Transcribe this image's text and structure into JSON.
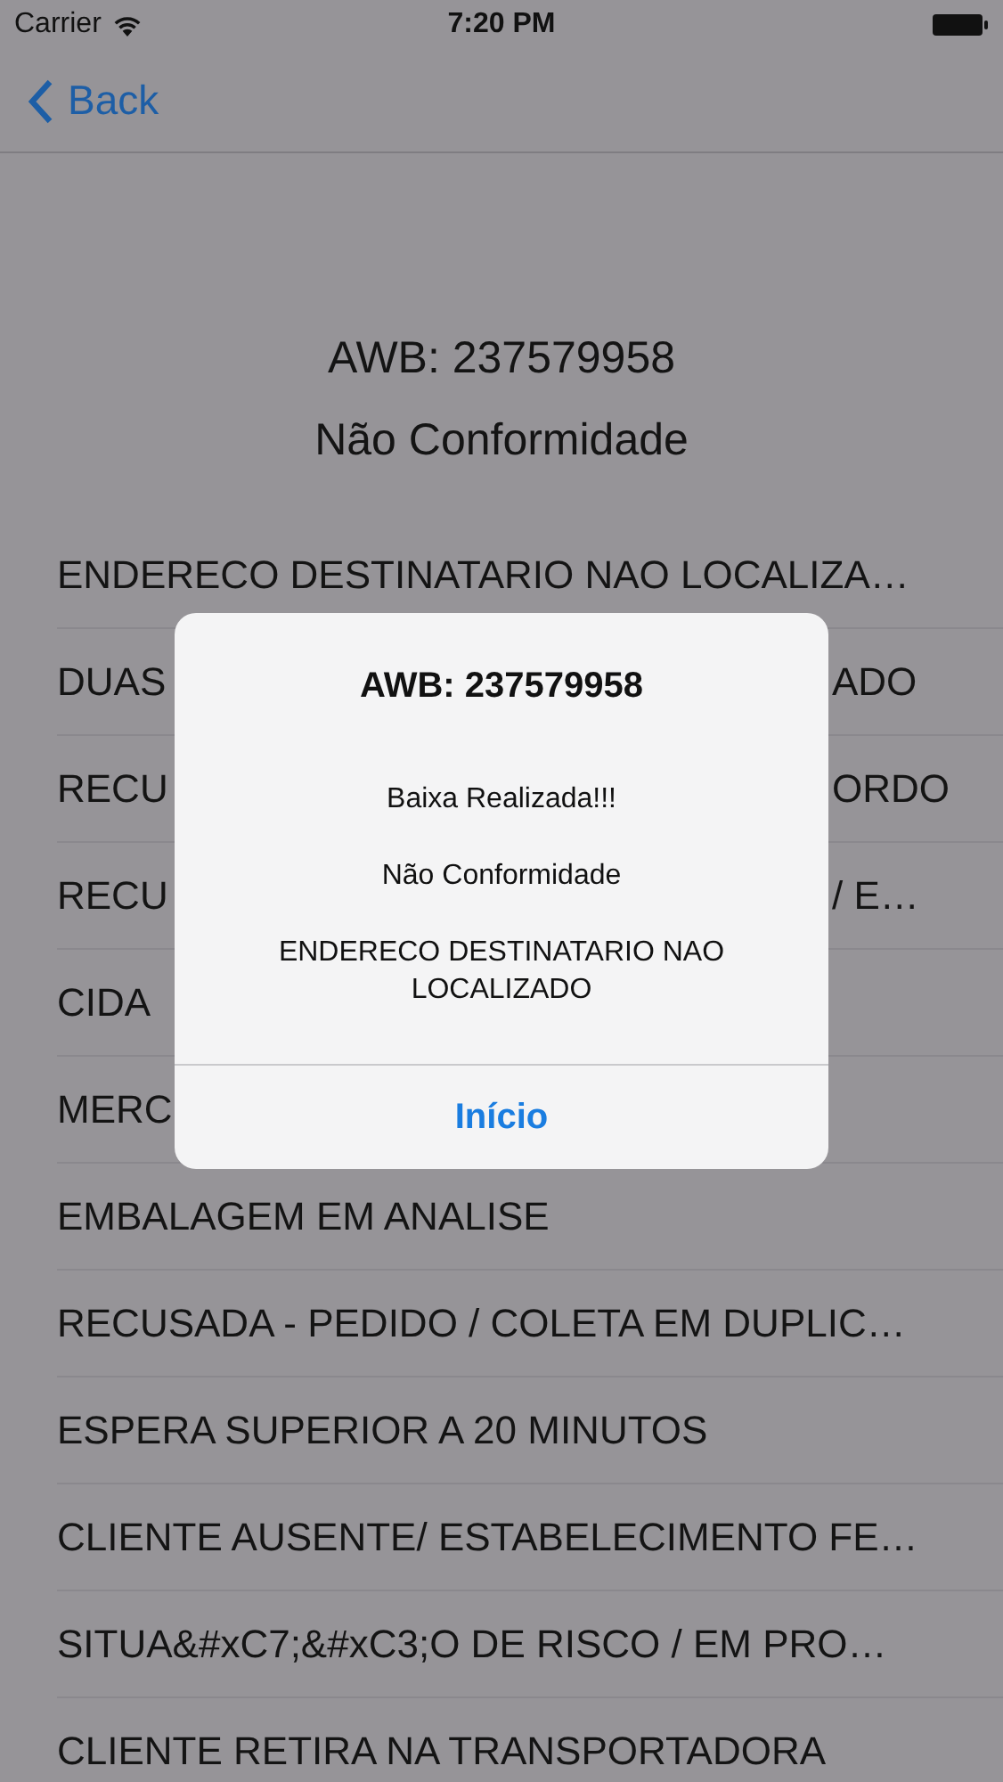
{
  "status_bar": {
    "carrier": "Carrier",
    "time": "7:20 PM"
  },
  "nav": {
    "back": "Back"
  },
  "header": {
    "awb": "AWB: 237579958",
    "subtitle": "Não Conformidade"
  },
  "rows": [
    {
      "kind": "full",
      "text": "ENDERECO DESTINATARIO NAO LOCALIZA…"
    },
    {
      "kind": "covered",
      "left": "DUAS",
      "right": "ADO"
    },
    {
      "kind": "covered",
      "left": "RECU",
      "right": "ORDO"
    },
    {
      "kind": "covered",
      "left": "RECU",
      "right": "/ E…"
    },
    {
      "kind": "covered",
      "left": "CIDA"
    },
    {
      "kind": "covered",
      "left": "MERC"
    },
    {
      "kind": "full",
      "text": "EMBALAGEM EM ANALISE"
    },
    {
      "kind": "full",
      "text": "RECUSADA - PEDIDO / COLETA EM DUPLIC…"
    },
    {
      "kind": "full",
      "text": "ESPERA SUPERIOR A 20 MINUTOS"
    },
    {
      "kind": "full",
      "text": "CLIENTE AUSENTE/ ESTABELECIMENTO FE…"
    },
    {
      "kind": "full",
      "text": "SITUA&#xC7;&#xC3;O DE RISCO / EM PRO…"
    },
    {
      "kind": "full",
      "text": "CLIENTE RETIRA NA TRANSPORTADORA"
    }
  ],
  "alert": {
    "title": "AWB: 237579958",
    "messages": [
      "Baixa Realizada!!!",
      "Não Conformidade",
      "ENDERECO DESTINATARIO NAO LOCALIZADO"
    ],
    "button": "Início"
  }
}
